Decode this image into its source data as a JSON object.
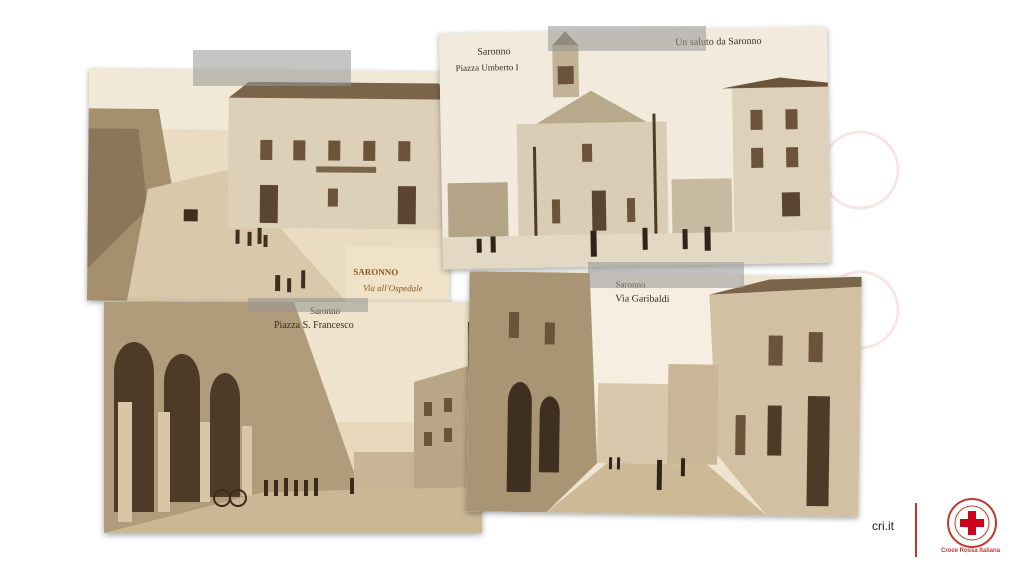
{
  "slide": {
    "photos": [
      {
        "id": "photo-1",
        "caption_top_left": "",
        "caption_bottom": "Via all'Ospedale",
        "caption_bottom_prefix": "SARONNO"
      },
      {
        "id": "photo-2",
        "caption_top_left": "Saronno",
        "caption_top_left_2": "Piazza Umberto I",
        "caption_top_right": "Un saluto da Saronno"
      },
      {
        "id": "photo-3",
        "caption_top_left": "Saronno",
        "caption_top_left_2": "Piazza S. Francesco"
      },
      {
        "id": "photo-4",
        "caption_top_left": "Saronno",
        "caption_top_left_2": "Via Garibaldi"
      }
    ]
  },
  "footer": {
    "website": "cri.it",
    "organization": "Croce Rossa Italiana"
  },
  "colors": {
    "accent": "#c0392b",
    "sepia_light": "#e9dcc3",
    "sepia_mid": "#c7b292",
    "sepia_dark": "#6b543a"
  }
}
